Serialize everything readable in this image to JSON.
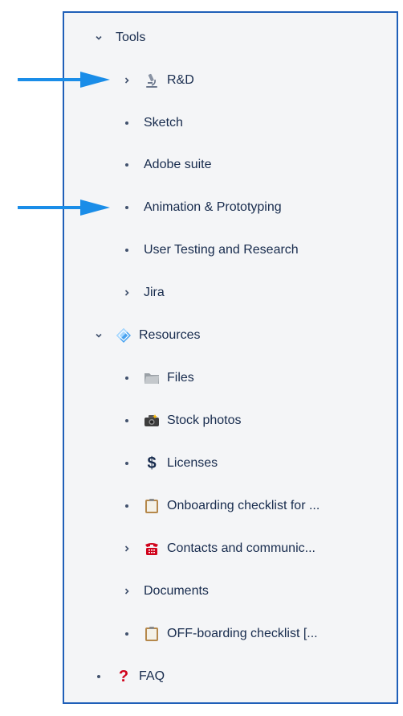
{
  "tree": {
    "tools": {
      "label": "Tools",
      "state": "expanded"
    },
    "rnd": {
      "label": "R&D",
      "icon": "microscope-icon",
      "state": "collapsed"
    },
    "sketch": {
      "label": "Sketch"
    },
    "adobe": {
      "label": "Adobe suite"
    },
    "animation": {
      "label": "Animation & Prototyping"
    },
    "user_testing": {
      "label": "User Testing and Research"
    },
    "jira": {
      "label": "Jira",
      "state": "collapsed"
    },
    "resources": {
      "label": "Resources",
      "icon": "diamond-icon",
      "state": "expanded"
    },
    "files": {
      "label": "Files",
      "icon": "folder-icon"
    },
    "stock": {
      "label": "Stock photos",
      "icon": "camera-icon"
    },
    "licenses": {
      "label": "Licenses",
      "icon": "dollar-icon"
    },
    "onboarding": {
      "label": "Onboarding checklist for ...",
      "icon": "clipboard-icon"
    },
    "contacts": {
      "label": "Contacts and communic...",
      "icon": "telephone-icon",
      "state": "collapsed"
    },
    "documents": {
      "label": "Documents",
      "state": "collapsed"
    },
    "offboarding": {
      "label": "OFF-boarding checklist [...",
      "icon": "clipboard-icon"
    },
    "faq": {
      "label": "FAQ",
      "icon": "question-icon"
    }
  },
  "colors": {
    "panel_bg": "#f4f5f7",
    "panel_border": "#1f5fb8",
    "annotation_arrow": "#1a8de8",
    "text": "#172b4d"
  },
  "annotations": [
    {
      "name": "annotation-arrow",
      "points_to": "R&D"
    },
    {
      "name": "annotation-arrow",
      "points_to": "Animation & Prototyping"
    }
  ]
}
